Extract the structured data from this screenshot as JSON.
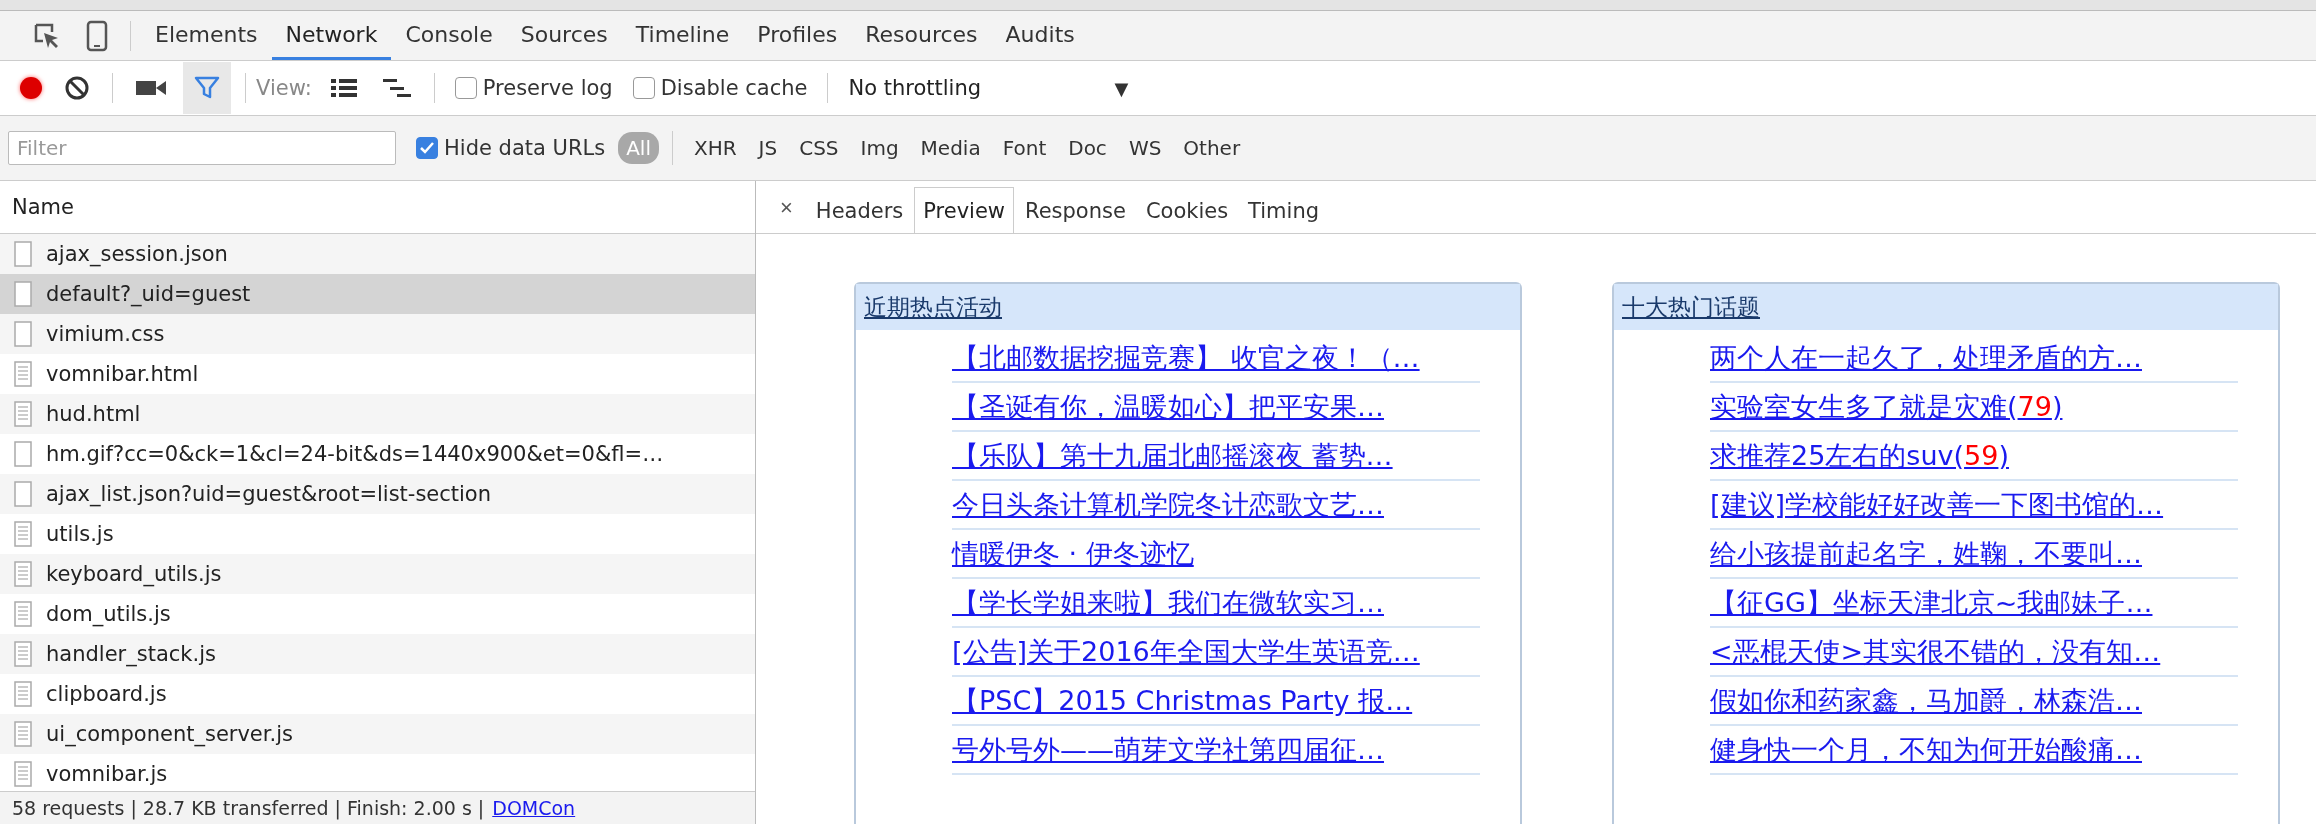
{
  "tabs": [
    {
      "label": "Elements",
      "selected": false
    },
    {
      "label": "Network",
      "selected": true
    },
    {
      "label": "Console",
      "selected": false
    },
    {
      "label": "Sources",
      "selected": false
    },
    {
      "label": "Timeline",
      "selected": false
    },
    {
      "label": "Profiles",
      "selected": false
    },
    {
      "label": "Resources",
      "selected": false
    },
    {
      "label": "Audits",
      "selected": false
    }
  ],
  "toolbar": {
    "recording": true,
    "filter_on": true,
    "view_label": "View:",
    "preserve_log": {
      "label": "Preserve log",
      "checked": false
    },
    "disable_cache": {
      "label": "Disable cache",
      "checked": false
    },
    "throttling": "No throttling",
    "dropdown_arrow": "▼"
  },
  "filter_bar": {
    "placeholder": "Filter",
    "hide_data_urls": {
      "label": "Hide data URLs",
      "checked": true
    },
    "types": [
      {
        "label": "All",
        "selected": true
      },
      {
        "label": "XHR",
        "selected": false
      },
      {
        "label": "JS",
        "selected": false
      },
      {
        "label": "CSS",
        "selected": false
      },
      {
        "label": "Img",
        "selected": false
      },
      {
        "label": "Media",
        "selected": false
      },
      {
        "label": "Font",
        "selected": false
      },
      {
        "label": "Doc",
        "selected": false
      },
      {
        "label": "WS",
        "selected": false
      },
      {
        "label": "Other",
        "selected": false
      }
    ]
  },
  "requests": {
    "column": "Name",
    "rows": [
      {
        "name": "ajax_session.json",
        "kind": "blank",
        "selected": false
      },
      {
        "name": "default?_uid=guest",
        "kind": "blank",
        "selected": true
      },
      {
        "name": "vimium.css",
        "kind": "blank",
        "selected": false
      },
      {
        "name": "vomnibar.html",
        "kind": "text",
        "selected": false
      },
      {
        "name": "hud.html",
        "kind": "text",
        "selected": false
      },
      {
        "name": "hm.gif?cc=0&ck=1&cl=24-bit&ds=1440x900&et=0&fl=…",
        "kind": "blank",
        "selected": false
      },
      {
        "name": "ajax_list.json?uid=guest&root=list-section",
        "kind": "blank",
        "selected": false
      },
      {
        "name": "utils.js",
        "kind": "text",
        "selected": false
      },
      {
        "name": "keyboard_utils.js",
        "kind": "text",
        "selected": false
      },
      {
        "name": "dom_utils.js",
        "kind": "text",
        "selected": false
      },
      {
        "name": "handler_stack.js",
        "kind": "text",
        "selected": false
      },
      {
        "name": "clipboard.js",
        "kind": "text",
        "selected": false
      },
      {
        "name": "ui_component_server.js",
        "kind": "text",
        "selected": false
      },
      {
        "name": "vomnibar.js",
        "kind": "text",
        "selected": false
      }
    ],
    "status": "58 requests | 28.7 KB transferred | Finish: 2.00 s |",
    "status_link": "DOMCon"
  },
  "detail": {
    "close": "×",
    "tabs": [
      {
        "label": "Headers",
        "selected": false
      },
      {
        "label": "Preview",
        "selected": true
      },
      {
        "label": "Response",
        "selected": false
      },
      {
        "label": "Cookies",
        "selected": false
      },
      {
        "label": "Timing",
        "selected": false
      }
    ]
  },
  "preview": [
    {
      "title": "近期热点活动",
      "items": [
        {
          "text": "【北邮数据挖掘竞赛】 收官之夜！（…"
        },
        {
          "text": "【圣诞有你，温暖如心】把平安果…"
        },
        {
          "text": "【乐队】第十九届北邮摇滚夜 蓄势…"
        },
        {
          "text": "今日头条计算机学院冬计恋歌文艺…"
        },
        {
          "text": "情暖伊冬 · 伊冬迹忆"
        },
        {
          "text": "【学长学姐来啦】我们在微软实习…"
        },
        {
          "text": "[公告]关于2016年全国大学生英语竞…"
        },
        {
          "text": "【PSC】2015 Christmas Party 报…"
        },
        {
          "text": "号外号外——萌芽文学社第四届征…"
        }
      ]
    },
    {
      "title": "十大热门话题",
      "items": [
        {
          "text": "两个人在一起久了，处理矛盾的方…"
        },
        {
          "text": "实验室女生多了就是灾难(",
          "count": "79",
          "tail": ")"
        },
        {
          "text": "求推荐25左右的suv(",
          "count": "59",
          "tail": ")"
        },
        {
          "text": "[建议]学校能好好改善一下图书馆的…"
        },
        {
          "text": "给小孩提前起名字，姓鞠，不要叫…"
        },
        {
          "text": "【征GG】坐标天津北京~我邮妹子…"
        },
        {
          "text": "<恶棍天使>其实很不错的，没有知…"
        },
        {
          "text": "假如你和药家鑫，马加爵，林森浩…"
        },
        {
          "text": "健身快一个月，不知为何开始酸痛…"
        }
      ]
    }
  ]
}
